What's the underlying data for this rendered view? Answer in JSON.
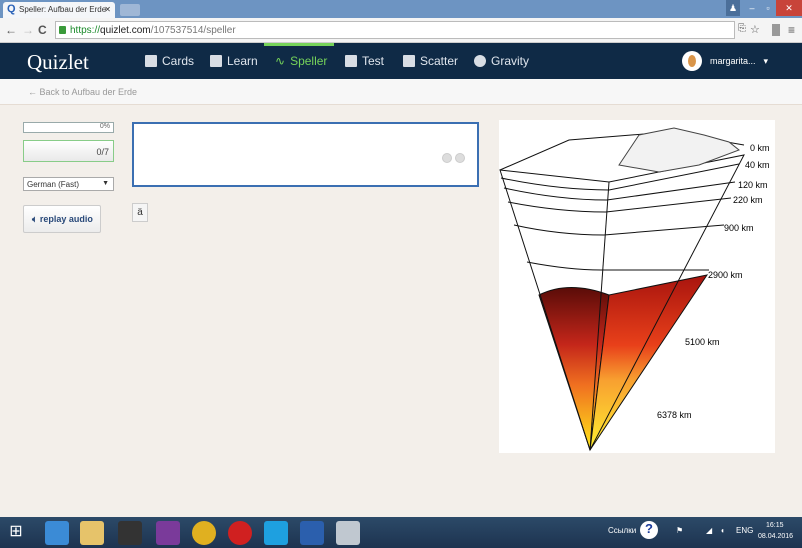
{
  "browser": {
    "tab_title": "Speller: Aufbau der Erde",
    "url_scheme": "https://",
    "url_host": "quizlet.com",
    "url_path": "/107537514/speller"
  },
  "nav": {
    "logo": "Quizlet",
    "items": [
      {
        "label": "Cards"
      },
      {
        "label": "Learn"
      },
      {
        "label": "Speller",
        "active": true
      },
      {
        "label": "Test"
      },
      {
        "label": "Scatter"
      },
      {
        "label": "Gravity"
      }
    ],
    "user": "margarita..."
  },
  "back_link": "← Back to Aufbau der Erde",
  "speller": {
    "progress_percent": "0%",
    "progress": 0,
    "score": "0/7",
    "voice": "German (Fast)",
    "replay_label": "replay audio",
    "answer": "",
    "accent_key": "ä"
  },
  "diagram": {
    "labels": [
      "0 km",
      "40 km",
      "120 km",
      "220 km",
      "900 km",
      "2900 km",
      "5100 km",
      "6378 km"
    ]
  },
  "taskbar": {
    "links_label": "Ссылки",
    "lang": "ENG",
    "time": "16:15",
    "date": "08.04.2016"
  },
  "colors": {
    "accent": "#76d35a",
    "nav_bg": "#0f2a46",
    "input_border": "#3b6fb2"
  }
}
